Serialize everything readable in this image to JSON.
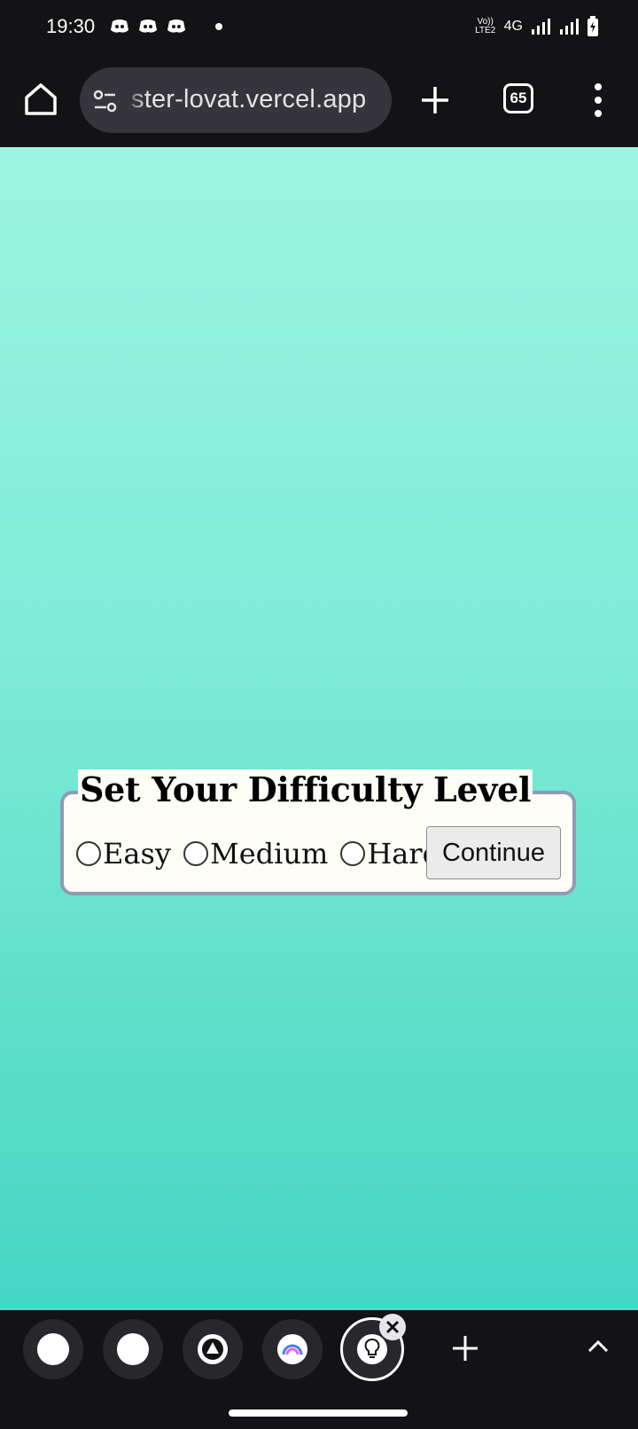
{
  "status_bar": {
    "time": "19:30",
    "volte_top": "Vo))",
    "volte_bottom": "LTE2",
    "network": "4G",
    "icons": [
      "discord-icon",
      "discord-icon",
      "discord-icon",
      "notification-dot",
      "signal-icon",
      "signal-icon",
      "battery-icon"
    ]
  },
  "toolbar": {
    "url": "ster-lovat.vercel.app",
    "tab_count": "65",
    "icons": [
      "home-icon",
      "site-settings-icon",
      "new-tab-icon",
      "tab-switcher-icon",
      "more-menu-icon"
    ]
  },
  "page": {
    "title": "Set Your Difficulty Level",
    "options": [
      {
        "label": "Easy",
        "selected": false
      },
      {
        "label": "Medium",
        "selected": false
      },
      {
        "label": "Hard",
        "selected": false
      }
    ],
    "continue_label": "Continue",
    "colors": {
      "bg_top": "#9cf5e2",
      "bg_bottom": "#45d6c4",
      "card_bg": "#fefef6",
      "card_border": "#909ab6"
    }
  },
  "bottom_bar": {
    "apps": [
      "app-shortcut-1",
      "app-shortcut-2",
      "app-shortcut-3",
      "app-shortcut-4",
      "app-shortcut-5"
    ],
    "icons": [
      "close-icon",
      "add-icon",
      "chevron-up-icon"
    ]
  }
}
